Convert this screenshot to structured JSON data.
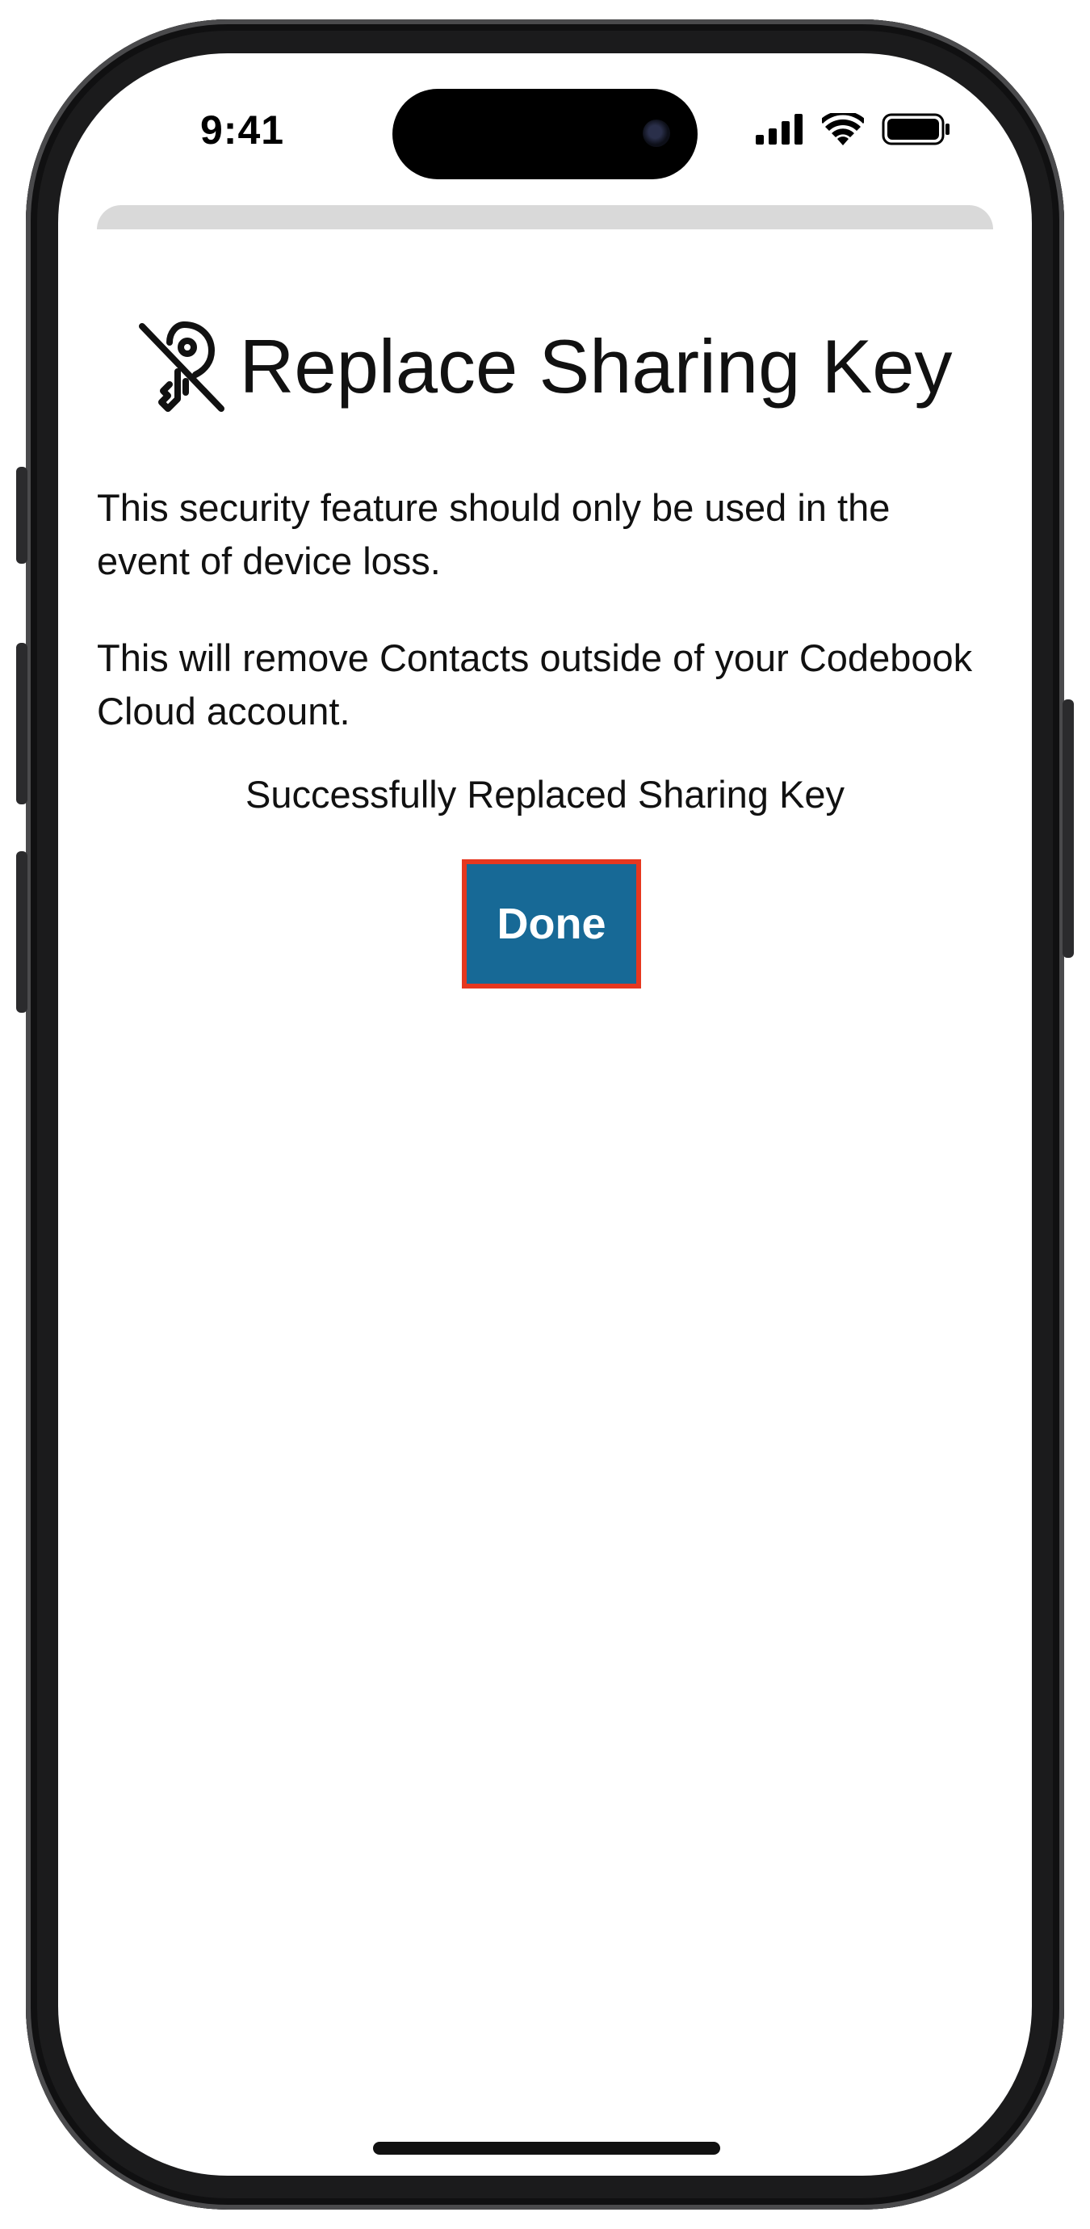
{
  "status_bar": {
    "time": "9:41",
    "icons": [
      "cellular-signal-icon",
      "wifi-icon",
      "battery-icon"
    ]
  },
  "sheet": {
    "title": "Replace Sharing Key",
    "title_icon": "key-slash-icon",
    "description_1": "This security feature should only be used in the event of device loss.",
    "description_2": "This will remove Contacts outside of your Codebook Cloud account.",
    "success_message": "Successfully Replaced Sharing Key",
    "done_label": "Done"
  },
  "colors": {
    "button_background": "#176996",
    "button_highlight_border": "#e6371f",
    "sheet_handle": "#d9d9d9",
    "text": "#111111"
  }
}
